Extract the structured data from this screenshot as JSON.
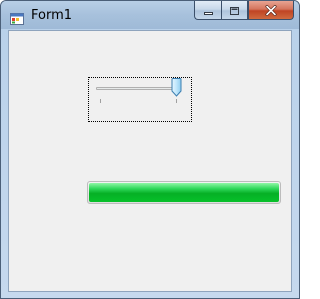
{
  "window": {
    "title": "Form1",
    "icons": {
      "app": "form-app-icon",
      "minimize": "minimize-icon",
      "maximize": "maximize-icon",
      "close": "close-icon"
    }
  },
  "trackbar": {
    "minimum": 0,
    "maximum": 10,
    "value": 10,
    "focused": true
  },
  "progress": {
    "value": 1.0,
    "color": "#06b025"
  }
}
